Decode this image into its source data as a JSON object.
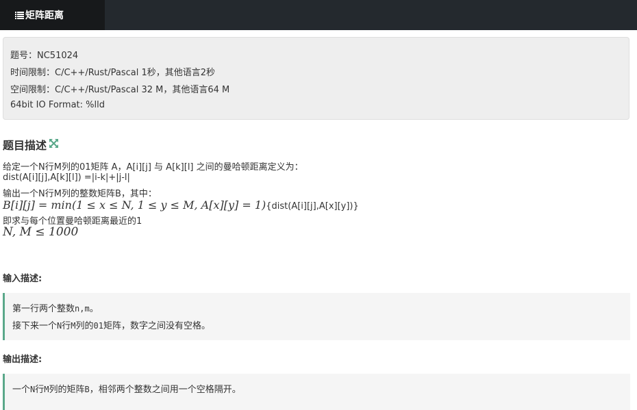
{
  "header": {
    "tab_label": "矩阵距离",
    "tab_icon": "list-icon"
  },
  "info": {
    "problem_id": "题号：NC51024",
    "time_limit": "时间限制：C/C++/Rust/Pascal 1秒，其他语言2秒",
    "memory_limit": "空间限制：C/C++/Rust/Pascal 32 M，其他语言64 M",
    "io_format": "64bit IO Format: %lld"
  },
  "description": {
    "title": "题目描述",
    "expand_icon": "expand-icon",
    "line1": "给定一个N行M列的01矩阵 A，A[i][j] 与 A[k][l] 之间的曼哈顿距离定义为：",
    "line2": "dist(A[i][j],A[k][l]) =|i-k|+|j-l|",
    "line3": "输出一个N行M列的整数矩阵B，其中：",
    "formula_math": "B[i][j] = min(1 ≤ x ≤ N, 1 ≤ y ≤ M, A[x][y] = 1)",
    "formula_tail": "{dist(A[i][j],A[x][y])}",
    "line5": "即求与每个位置曼哈顿距离最近的1",
    "constraint": "N, M ≤ 1000"
  },
  "input": {
    "title": "输入描述:",
    "line1_a": "第一行两个整数",
    "line1_b": "n,m",
    "line1_c": "。",
    "line2_a": "接下来一个",
    "line2_b": "N",
    "line2_c": "行",
    "line2_d": "M",
    "line2_e": "列的",
    "line2_f": "01",
    "line2_g": "矩阵，数字之间没有空格。"
  },
  "output": {
    "title": "输出描述:",
    "line1_a": "一个",
    "line1_b": "N",
    "line1_c": "行",
    "line1_d": "M",
    "line1_e": "列的矩阵",
    "line1_f": "B",
    "line1_g": "，相邻两个整数之间用一个空格隔开。"
  },
  "colors": {
    "topbar": "#24292e",
    "tab_bg": "#17191b",
    "accent": "#5aa88a"
  }
}
